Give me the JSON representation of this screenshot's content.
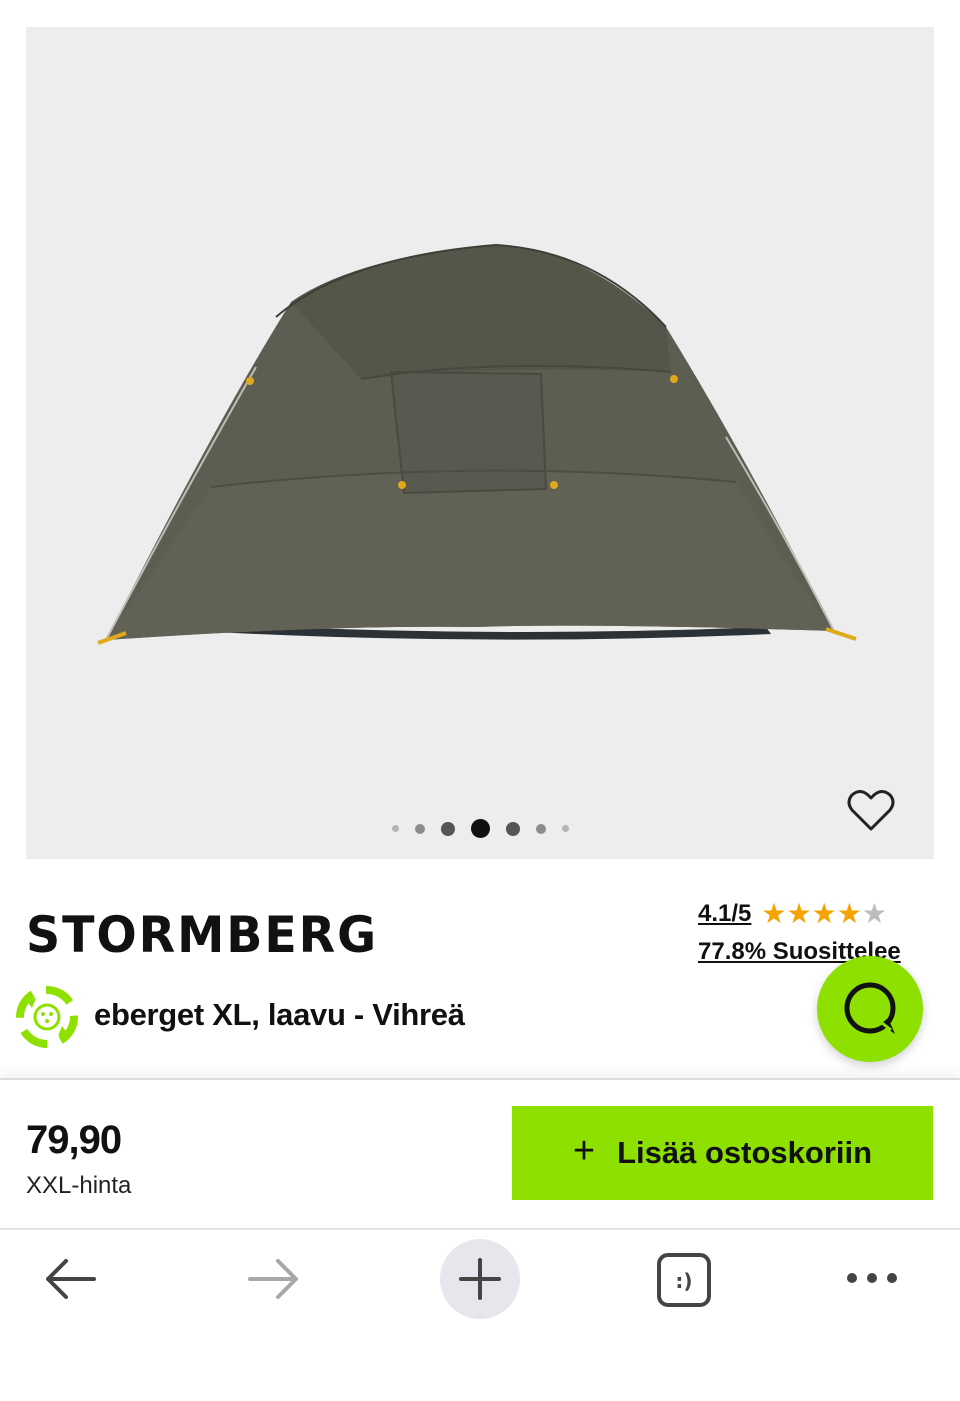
{
  "gallery": {
    "image_alt": "Stormberg tent",
    "dots_count": 7,
    "active_dot_index": 3,
    "favorite_icon": "heart-outline-icon"
  },
  "brand": {
    "name": "STORMBERG"
  },
  "rating": {
    "score": "4.1/5",
    "stars_value": 4.1,
    "stars_max": 5,
    "recommend_text": "77.8% Suosittelee"
  },
  "product": {
    "title": "eberget XL, laavu - Vihreä",
    "eco_icon": "eco-recycle-icon"
  },
  "chat": {
    "icon": "chat-bubble-icon"
  },
  "buy": {
    "price": "79,90",
    "price_label": "XXL-hinta",
    "add_to_cart_label": "Lisää ostoskoriin",
    "add_icon": "plus-icon"
  },
  "browser": {
    "back_icon": "arrow-left-icon",
    "forward_icon": "arrow-right-icon",
    "new_tab_icon": "plus-icon",
    "tabs_icon": "tabs-icon",
    "tabs_glyph": ":)",
    "more_icon": "more-dots-icon"
  },
  "colors": {
    "accent": "#8ee000",
    "star": "#f5a300",
    "gallery_bg": "#ededed"
  }
}
